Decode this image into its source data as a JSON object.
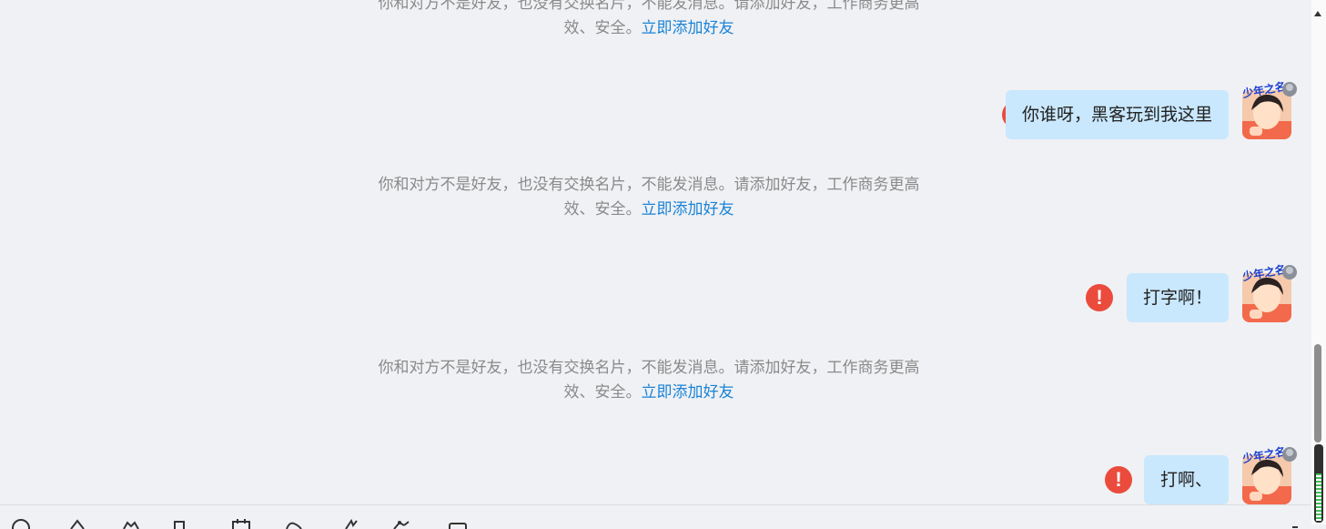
{
  "notices": [
    {
      "text": "你和对方不是好友，也没有交换名片，不能发消息。请添加好友，工作商务更高效、安全。",
      "link": "立即添加好友"
    },
    {
      "text": "你和对方不是好友，也没有交换名片，不能发消息。请添加好友，工作商务更高效、安全。",
      "link": "立即添加好友"
    },
    {
      "text": "你和对方不是好友，也没有交换名片，不能发消息。请添加好友，工作商务更高效、安全。",
      "link": "立即添加好友"
    }
  ],
  "messages": [
    {
      "text": "你谁呀，黑客玩到我这里",
      "status": "send-failed"
    },
    {
      "text": "打字啊！",
      "status": "send-failed"
    },
    {
      "text": "打啊、",
      "status": "send-failed"
    }
  ],
  "colors": {
    "bubble": "#c9e7fd",
    "error": "#ea4b3c",
    "link": "#1a83d6",
    "background": "#f0f1f4"
  },
  "icons": {
    "error": "exclamation-circle-icon",
    "avatar": "user-avatar"
  }
}
